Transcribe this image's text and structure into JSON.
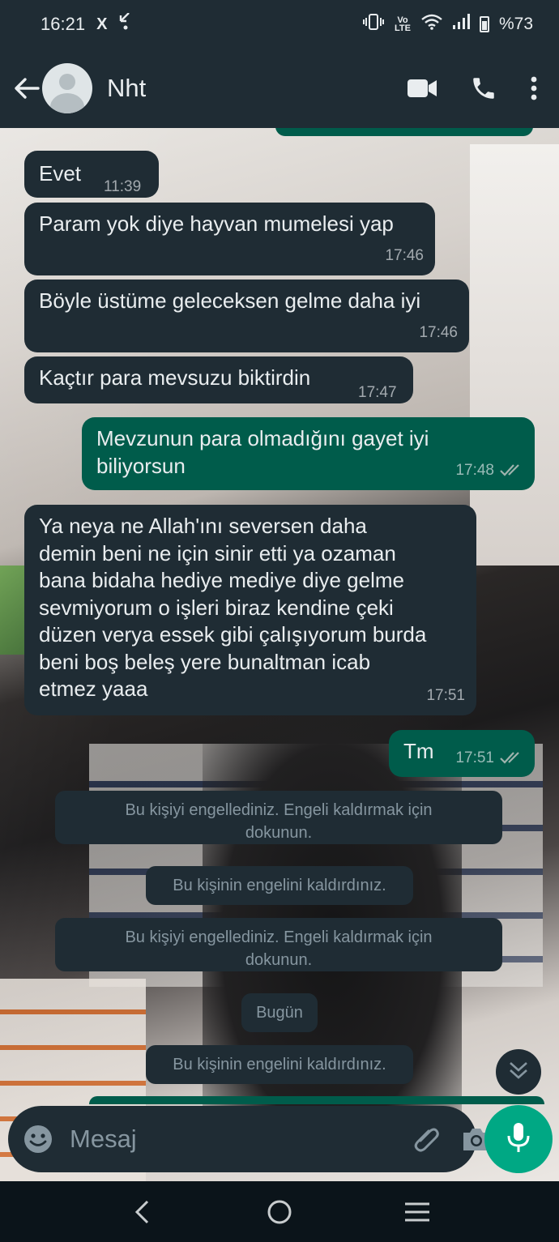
{
  "status_bar": {
    "time": "16:21",
    "x_icon": "X",
    "lte_label": "Vo LTE",
    "battery": "%73"
  },
  "header": {
    "contact_name": "Nht",
    "icons": [
      "back-arrow-icon",
      "video-call-icon",
      "phone-icon",
      "more-vert-icon"
    ]
  },
  "messages": [
    {
      "dir": "in",
      "text": "Evet",
      "time": "11:39"
    },
    {
      "dir": "in",
      "text": "Param yok diye hayvan mumelesi yap",
      "time": "17:46"
    },
    {
      "dir": "in",
      "text": "Böyle üstüme geleceksen gelme daha iyi",
      "time": "17:46"
    },
    {
      "dir": "in",
      "text": "Kaçtır para mevsuzu biktirdin",
      "time": "17:47"
    },
    {
      "dir": "out",
      "line1": "Mevzunun para olmadığını gayet iyi",
      "line2": "biliyorsun",
      "time": "17:48"
    },
    {
      "dir": "in",
      "lines": [
        "Ya neya ne Allah'ını seversen daha",
        "demin beni ne için sinir etti ya ozaman",
        "bana bidaha hediye mediye diye gelme",
        "sevmiyorum o işleri biraz kendine çeki",
        "düzen verya essek gibi çalışıyorum burda",
        "beni boş beleş yere bunaltman icab",
        "etmez yaaa"
      ],
      "time": "17:51"
    },
    {
      "dir": "out",
      "text": "Tm",
      "time": "17:51"
    }
  ],
  "system": {
    "blocked_1_l1": "Bu kişiyi engellediniz. Engeli kaldırmak için",
    "blocked_1_l2": "dokunun.",
    "unblocked_1": "Bu kişinin engelini kaldırdınız.",
    "blocked_2_l1": "Bu kişiyi engellediniz. Engeli kaldırmak için",
    "blocked_2_l2": "dokunun.",
    "date_chip": "Bugün",
    "unblocked_2": "Bu kişinin engelini kaldırdınız."
  },
  "composer": {
    "placeholder": "Mesaj"
  },
  "colors": {
    "incoming_bubble": "#1f2c34",
    "outgoing_bubble": "#005c4b",
    "accent": "#00a884",
    "tick_read": "#9fb3ad"
  }
}
